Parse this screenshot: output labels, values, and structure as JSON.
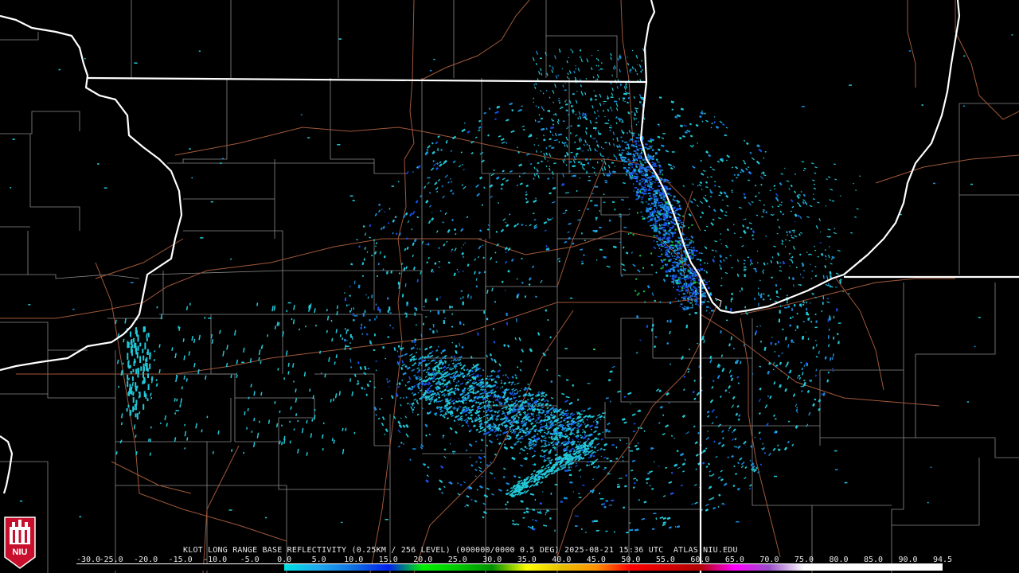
{
  "product_title": "KLOT LONG RANGE BASE REFLECTIVITY (0.25KM / 256 LEVEL) (000000/0000 0.5 DEG) 2025-08-21 15:36 UTC  ATLAS.NIU.EDU",
  "logo_text": "NIU",
  "scale": {
    "labels": [
      "-30.0",
      "-25.0",
      "-20.0",
      "-15.0",
      "-10.0",
      "-5.0",
      "0.0",
      "5.0",
      "10.0",
      "15.0",
      "20.0",
      "25.0",
      "30.0",
      "35.0",
      "40.0",
      "45.0",
      "50.0",
      "55.0",
      "60.0",
      "65.0",
      "70.0",
      "75.0",
      "80.0",
      "85.0",
      "90.0",
      "94.5"
    ],
    "colors": [
      "#000000",
      "#000000",
      "#000000",
      "#000000",
      "#000000",
      "#000000",
      "#00e0e0",
      "#20a8f0",
      "#1070e0",
      "#0020f0",
      "#00f000",
      "#00c800",
      "#009000",
      "#ffff00",
      "#e8c000",
      "#ff9000",
      "#ff0000",
      "#d80000",
      "#b00000",
      "#ff00ff",
      "#9850c8",
      "#ffffff",
      "#ffffff",
      "#ffffff",
      "#ffffff"
    ]
  },
  "colors": {
    "background": "#000000",
    "state_border": "#ffffff",
    "county_border": "#8a8a8a",
    "highway": "#a0583a",
    "echo_light": "#23c8d8",
    "echo_mid": "#1a8fe0",
    "echo_strong": "#1a50e8",
    "echo_green": "#18c848"
  },
  "radar_site": "KLOT"
}
